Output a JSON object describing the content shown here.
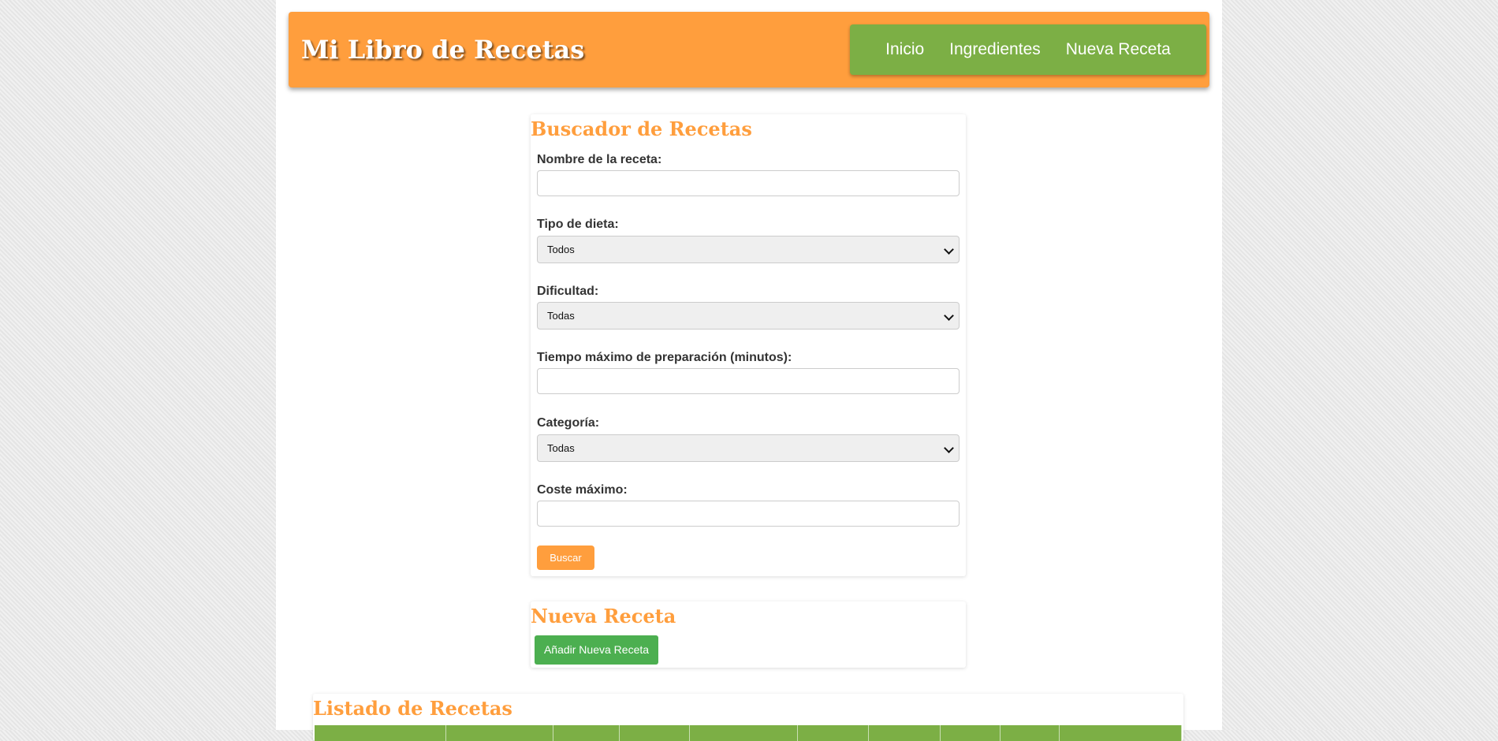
{
  "header": {
    "title": "Mi Libro de Recetas",
    "nav": [
      "Inicio",
      "Ingredientes",
      "Nueva Receta"
    ]
  },
  "search": {
    "title": "Buscador de Recetas",
    "name_label": "Nombre de la receta:",
    "name_value": "",
    "diet_label": "Tipo de dieta:",
    "diet_value": "Todos",
    "difficulty_label": "Dificultad:",
    "difficulty_value": "Todas",
    "time_label": "Tiempo máximo de preparación (minutos):",
    "time_value": "",
    "category_label": "Categoría:",
    "category_value": "Todas",
    "cost_label": "Coste máximo:",
    "cost_value": "",
    "button": "Buscar"
  },
  "new_recipe": {
    "title": "Nueva Receta",
    "button": "Añadir Nueva Receta"
  },
  "listing": {
    "title": "Listado de Recetas"
  },
  "colors": {
    "brand_orange": "#ff9e3d",
    "nav_green": "#7caf45",
    "add_button_green": "#4caf50"
  }
}
